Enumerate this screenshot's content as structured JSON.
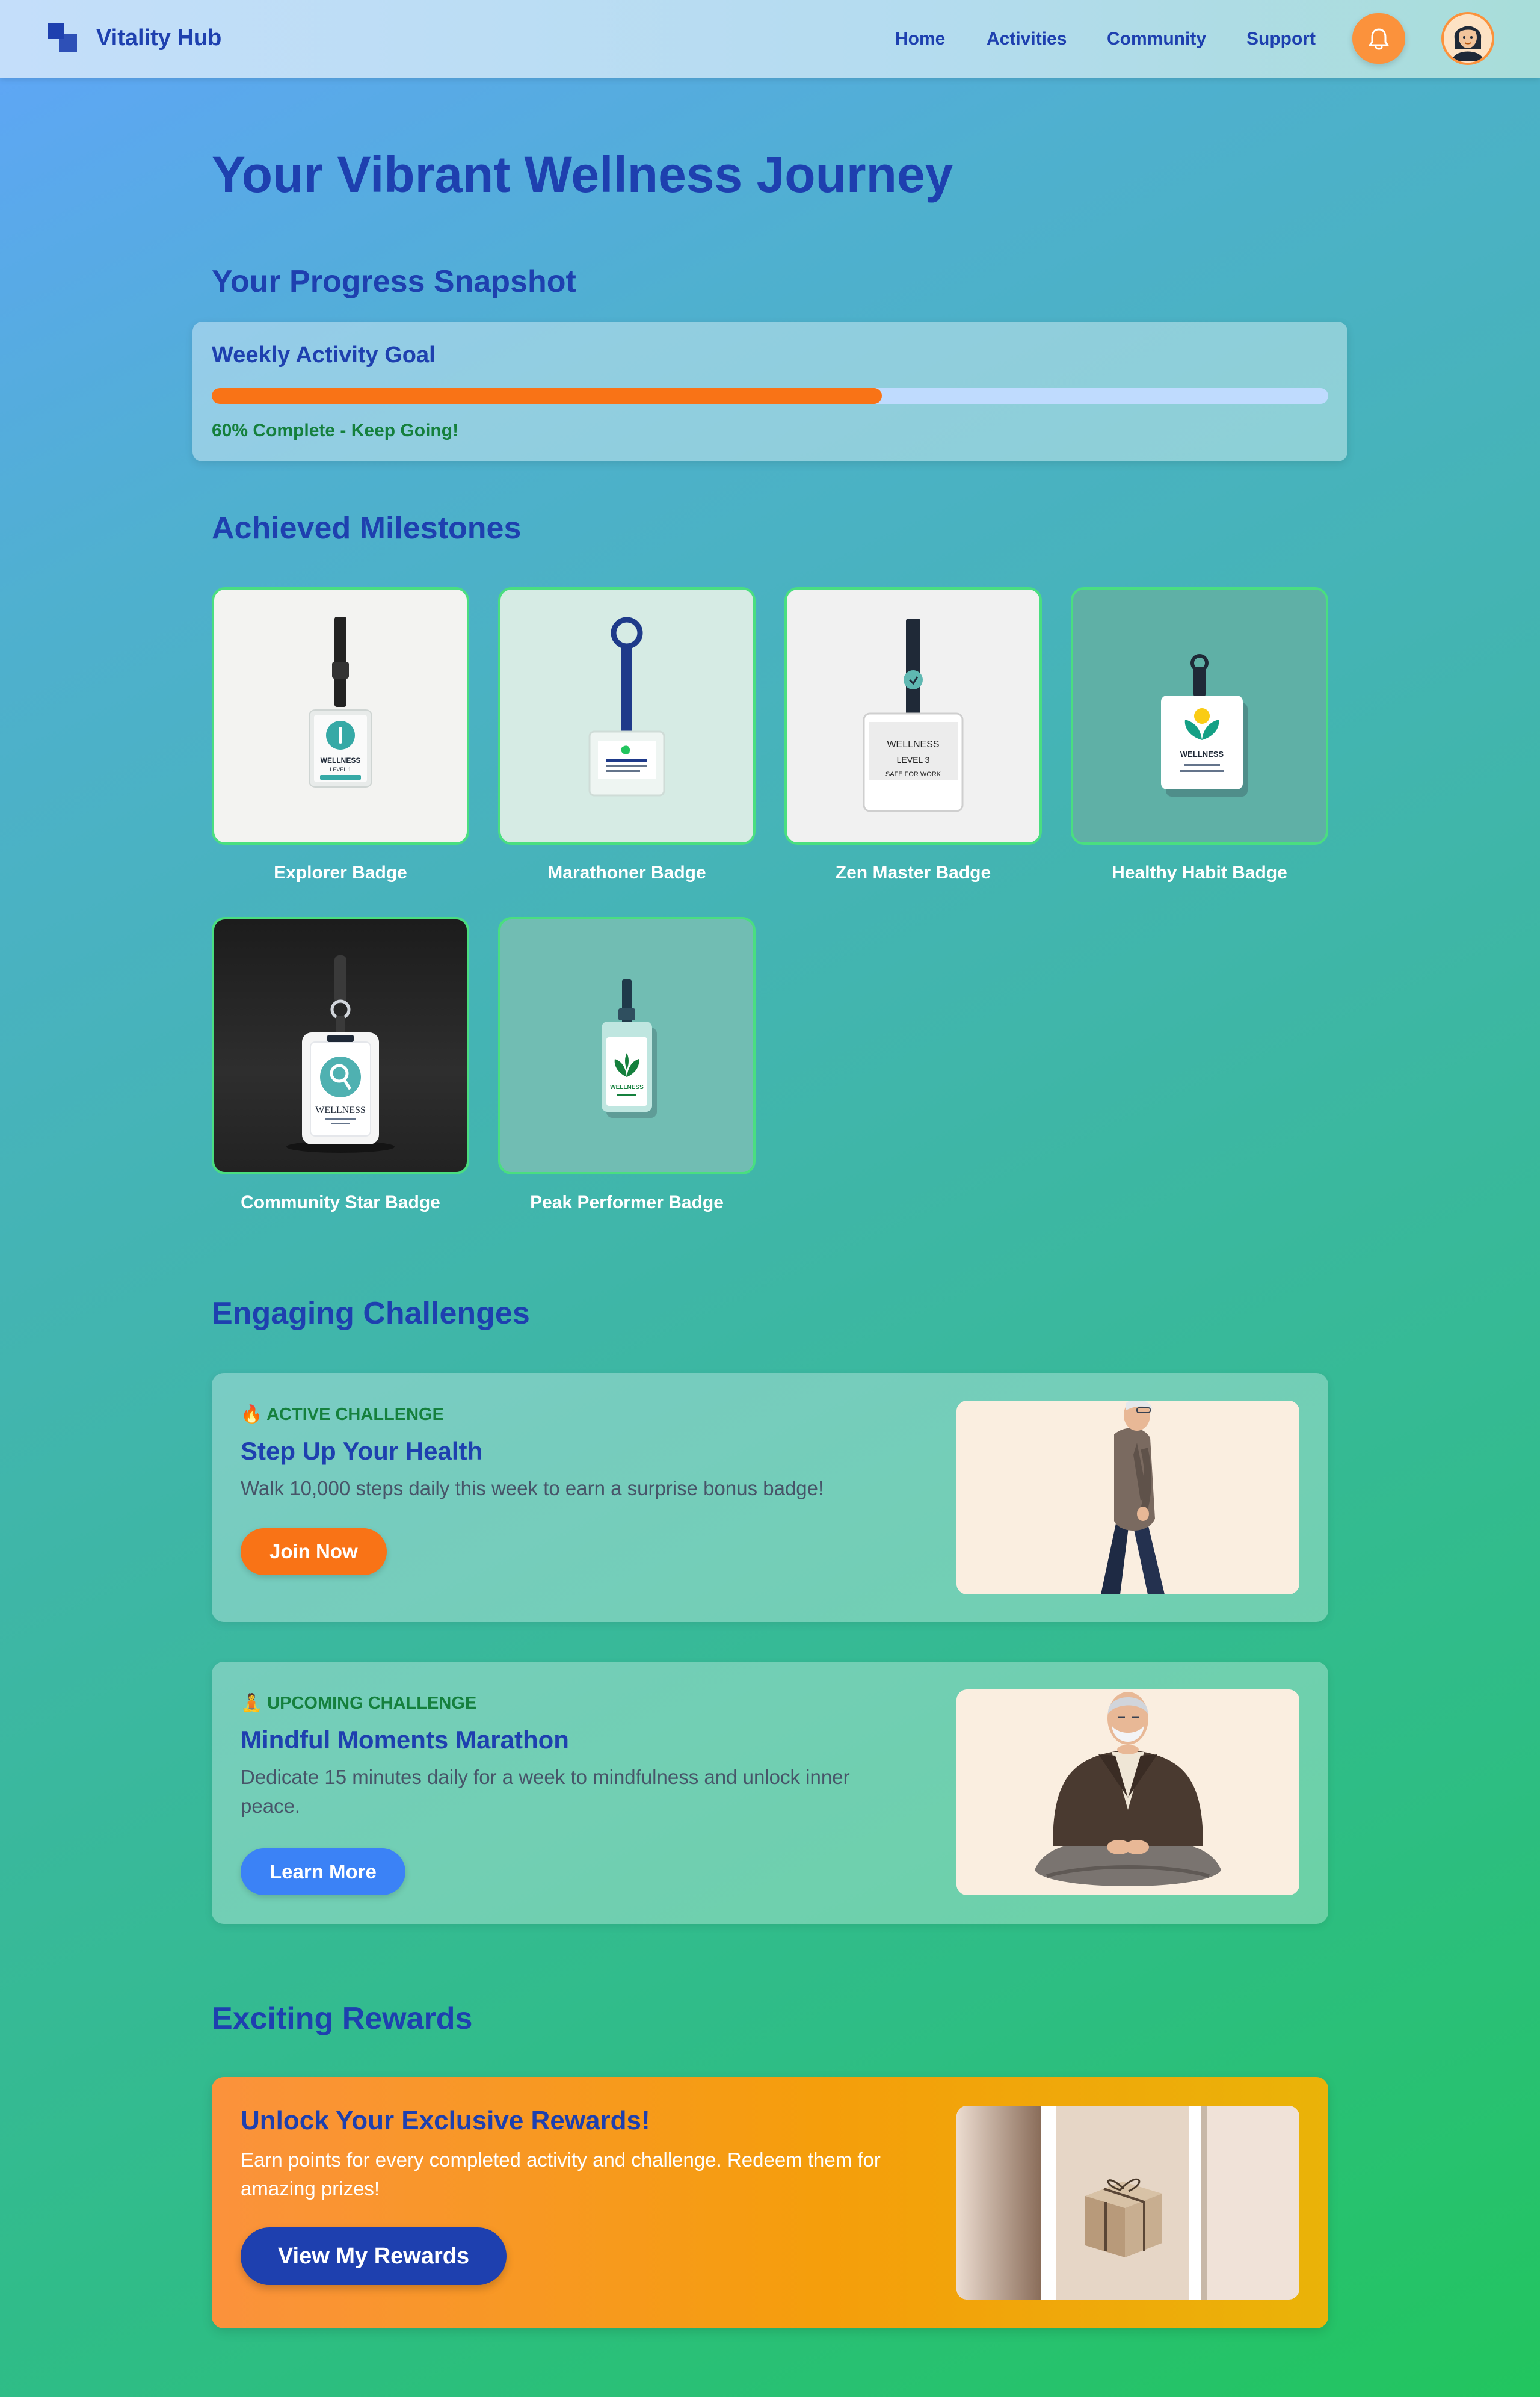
{
  "nav": {
    "brand": "Vitality Hub",
    "links": [
      "Home",
      "Activities",
      "Community",
      "Support"
    ],
    "notification_icon": "bell-icon",
    "avatar_icon": "user-avatar"
  },
  "page": {
    "title": "Your Vibrant Wellness Journey"
  },
  "progress": {
    "heading": "Your Progress Snapshot",
    "card_title": "Weekly Activity Goal",
    "percent": 60,
    "status_text": "60% Complete - Keep Going!"
  },
  "milestones": {
    "heading": "Achieved Milestones",
    "badges": [
      {
        "label": "Explorer Badge",
        "image_text": [
          "WELLNESS",
          "LEVEL 1"
        ]
      },
      {
        "label": "Marathoner Badge",
        "image_text": []
      },
      {
        "label": "Zen Master Badge",
        "image_text": [
          "WELLNESS",
          "LEVEL 3",
          "SAFE FOR WORK"
        ]
      },
      {
        "label": "Healthy Habit Badge",
        "image_text": [
          "WELLNESS"
        ]
      },
      {
        "label": "Community Star Badge",
        "image_text": [
          "WELLNESS"
        ]
      },
      {
        "label": "Peak Performer Badge",
        "image_text": [
          "WELLNESS"
        ]
      }
    ]
  },
  "challenges": {
    "heading": "Engaging Challenges",
    "items": [
      {
        "tag": "🔥 ACTIVE CHALLENGE",
        "title": "Step Up Your Health",
        "description": "Walk 10,000 steps daily this week to earn a surprise bonus badge!",
        "button": "Join Now"
      },
      {
        "tag": "🧘 UPCOMING CHALLENGE",
        "title": "Mindful Moments Marathon",
        "description": "Dedicate 15 minutes daily for a week to mindfulness and unlock inner peace.",
        "button": "Learn More"
      }
    ]
  },
  "rewards": {
    "heading": "Exciting Rewards",
    "title": "Unlock Your Exclusive Rewards!",
    "description": "Earn points for every completed activity and challenge. Redeem them for amazing prizes!",
    "button": "View My Rewards"
  },
  "colors": {
    "primary": "#1e40af",
    "accent_orange": "#f97316",
    "success_green": "#15803d",
    "badge_border": "#4ade80",
    "secondary_blue": "#3b82f6"
  }
}
